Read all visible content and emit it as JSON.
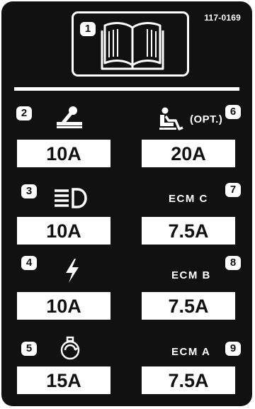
{
  "decal": {
    "part_number": "117-0169",
    "manual_icon": "operator-manual-icon",
    "manual_badge": "1"
  },
  "fuses": {
    "left": [
      {
        "number": "2",
        "icon": "operator-console-icon",
        "rating": "10A"
      },
      {
        "number": "3",
        "icon": "headlight-icon",
        "rating": "10A"
      },
      {
        "number": "4",
        "icon": "power-lightning-icon",
        "rating": "10A"
      },
      {
        "number": "5",
        "icon": "engine-icon",
        "rating": "15A"
      }
    ],
    "right": [
      {
        "number": "6",
        "icon": "seat-icon",
        "label": "(OPT.)",
        "rating": "20A"
      },
      {
        "number": "7",
        "label": "ECM C",
        "rating": "7.5A"
      },
      {
        "number": "8",
        "label": "ECM B",
        "rating": "7.5A"
      },
      {
        "number": "9",
        "label": "ECM A",
        "rating": "7.5A"
      }
    ]
  },
  "colors": {
    "background": "#111111",
    "foreground": "#ffffff"
  }
}
